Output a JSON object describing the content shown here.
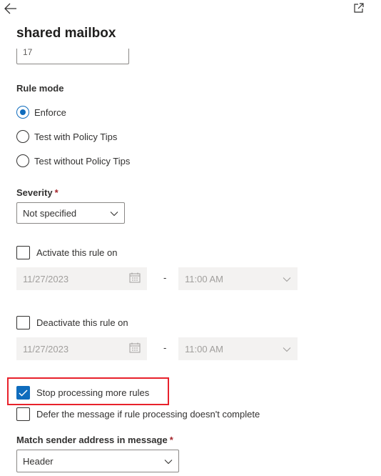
{
  "header": {
    "title": "shared mailbox",
    "back_icon": "arrow-left-icon",
    "popout_icon": "open-in-new-window-icon"
  },
  "top_field": {
    "value": "17"
  },
  "rule_mode": {
    "label": "Rule mode",
    "options": [
      {
        "label": "Enforce",
        "selected": true
      },
      {
        "label": "Test with Policy Tips",
        "selected": false
      },
      {
        "label": "Test without Policy Tips",
        "selected": false
      }
    ]
  },
  "severity": {
    "label": "Severity",
    "required_mark": "*",
    "value": "Not specified"
  },
  "activate": {
    "label": "Activate this rule on",
    "checked": false,
    "date": "11/27/2023",
    "dash": "-",
    "time": "11:00 AM"
  },
  "deactivate": {
    "label": "Deactivate this rule on",
    "checked": false,
    "date": "11/27/2023",
    "dash": "-",
    "time": "11:00 AM"
  },
  "stop_processing": {
    "label": "Stop processing more rules",
    "checked": true
  },
  "defer": {
    "label": "Defer the message if rule processing doesn't complete",
    "checked": false
  },
  "match_sender": {
    "label": "Match sender address in message",
    "required_mark": "*",
    "value": "Header"
  },
  "colors": {
    "accent": "#0f6cbd",
    "highlight": "#e8212b",
    "required": "#a4262c",
    "disabled_bg": "#f3f2f1"
  }
}
